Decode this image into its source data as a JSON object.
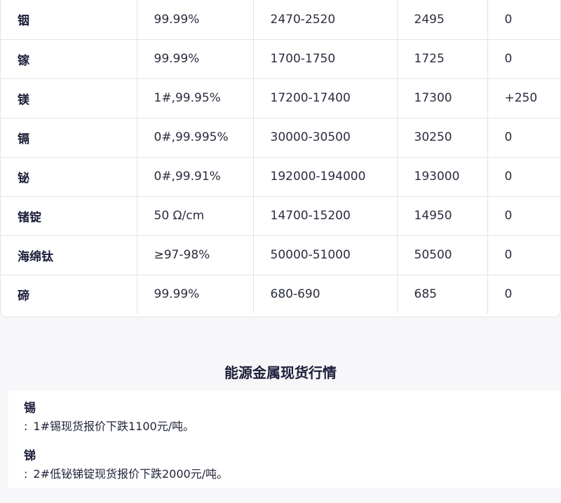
{
  "price_table": {
    "rows": [
      {
        "name": "铟",
        "spec": "99.99%",
        "range": "2470-2520",
        "avg": "2495",
        "change": "0"
      },
      {
        "name": "镓",
        "spec": "99.99%",
        "range": "1700-1750",
        "avg": "1725",
        "change": "0"
      },
      {
        "name": "镁",
        "spec": "1#,99.95%",
        "range": "17200-17400",
        "avg": "17300",
        "change": "+250"
      },
      {
        "name": "镉",
        "spec": "0#,99.995%",
        "range": "30000-30500",
        "avg": "30250",
        "change": "0"
      },
      {
        "name": "铋",
        "spec": "0#,99.91%",
        "range": "192000-194000",
        "avg": "193000",
        "change": "0"
      },
      {
        "name": "锗锭",
        "spec": "50 Ω/cm",
        "range": "14700-15200",
        "avg": "14950",
        "change": "0"
      },
      {
        "name": "海绵钛",
        "spec": "≥97-98%",
        "range": "50000-51000",
        "avg": "50500",
        "change": "0"
      },
      {
        "name": "碲",
        "spec": "99.99%",
        "range": "680-690",
        "avg": "685",
        "change": "0"
      }
    ]
  },
  "energy_section": {
    "title": "能源金属现货行情",
    "items": [
      {
        "metal": "锡",
        "separator": ":",
        "text": "1#锡现货报价下跌1100元/吨。"
      },
      {
        "metal": "锑",
        "separator": ":",
        "text": "2#低铋锑锭现货报价下跌2000元/吨。"
      }
    ]
  }
}
